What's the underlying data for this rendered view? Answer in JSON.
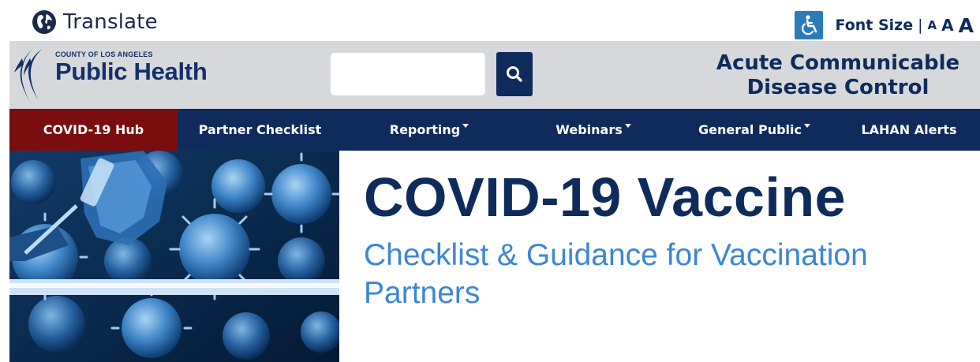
{
  "topbar": {
    "translate_label": "Translate",
    "font_size_label": "Font Size",
    "font_size_separator": "|",
    "font_size_small": "A",
    "font_size_medium": "A",
    "font_size_large": "A"
  },
  "header": {
    "logo_county": "COUNTY OF LOS ANGELES",
    "logo_name": "Public Health",
    "search_placeholder": "",
    "department_line1": "Acute Communicable",
    "department_line2": "Disease Control"
  },
  "nav": {
    "items": [
      {
        "label": "COVID-19 Hub",
        "active": true,
        "dropdown": false
      },
      {
        "label": "Partner Checklist",
        "active": false,
        "dropdown": false
      },
      {
        "label": "Reporting",
        "active": false,
        "dropdown": true
      },
      {
        "label": "Webinars",
        "active": false,
        "dropdown": true
      },
      {
        "label": "General Public",
        "active": false,
        "dropdown": true
      },
      {
        "label": "LAHAN Alerts",
        "active": false,
        "dropdown": false
      }
    ]
  },
  "hero": {
    "title": "COVID-19 Vaccine",
    "subtitle": "Checklist & Guidance for Vaccination Partners"
  },
  "colors": {
    "navy": "#0f2b5c",
    "active_red": "#7a0d0d",
    "header_gray": "#d6d8db",
    "subtitle_blue": "#3c86d6",
    "accessibility_blue": "#2a7bb8"
  },
  "icons": [
    "globe-icon",
    "accessibility-icon",
    "search-icon",
    "caret-down-icon"
  ]
}
